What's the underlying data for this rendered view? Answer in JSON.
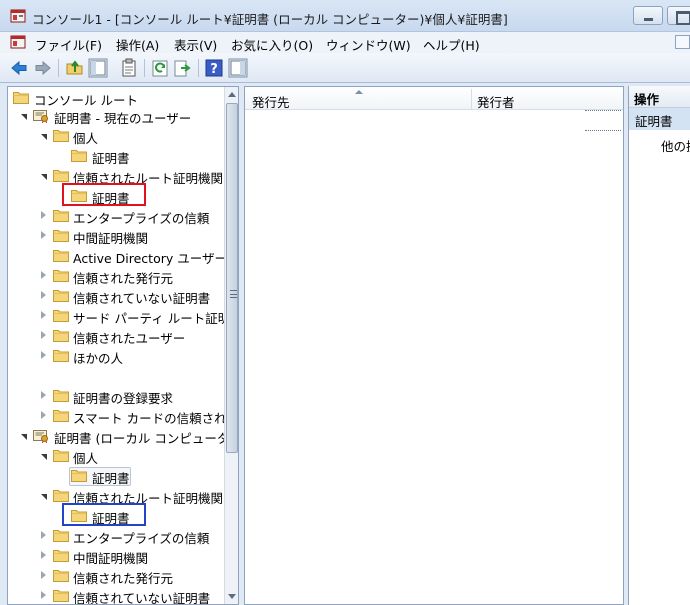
{
  "window": {
    "title": "コンソール1 - [コンソール ルート¥証明書 (ローカル コンピューター)¥個人¥証明書]"
  },
  "menu": [
    {
      "label": "ファイル(F)"
    },
    {
      "label": "操作(A)"
    },
    {
      "label": "表示(V)"
    },
    {
      "label": "お気に入り(O)"
    },
    {
      "label": "ウィンドウ(W)"
    },
    {
      "label": "ヘルプ(H)"
    }
  ],
  "toolbar": {
    "icons": [
      "back-arrow-icon",
      "forward-arrow-icon",
      "up-folder-icon",
      "show-hide-tree-icon",
      "properties-icon",
      "refresh-icon",
      "export-list-icon",
      "help-icon",
      "show-hide-action-pane-icon"
    ]
  },
  "tree": {
    "root": "コンソール ルート",
    "items": [
      {
        "label": "証明書 - 現在のユーザー"
      },
      {
        "label": "個人"
      },
      {
        "label": "証明書"
      },
      {
        "label": "信頼されたルート証明機関"
      },
      {
        "label": "証明書"
      },
      {
        "label": "エンタープライズの信頼"
      },
      {
        "label": "中間証明機関"
      },
      {
        "label": "Active Directory ユーザー"
      },
      {
        "label": "信頼された発行元"
      },
      {
        "label": "信頼されていない証明書"
      },
      {
        "label": "サード パーティ ルート証明"
      },
      {
        "label": "信頼されたユーザー"
      },
      {
        "label": "ほかの人"
      },
      {
        "label": "証明書の登録要求"
      },
      {
        "label": "スマート カードの信頼され"
      },
      {
        "label": "証明書 (ローカル コンピュータ"
      },
      {
        "label": "個人"
      },
      {
        "label": "証明書"
      },
      {
        "label": "信頼されたルート証明機関"
      },
      {
        "label": "証明書"
      },
      {
        "label": "エンタープライズの信頼"
      },
      {
        "label": "中間証明機関"
      },
      {
        "label": "信頼された発行元"
      },
      {
        "label": "信頼されていない証明書"
      }
    ]
  },
  "list": {
    "columns": [
      "発行先",
      "発行者"
    ]
  },
  "actions": {
    "title": "操作",
    "section": "証明書",
    "more": "他の操作"
  }
}
